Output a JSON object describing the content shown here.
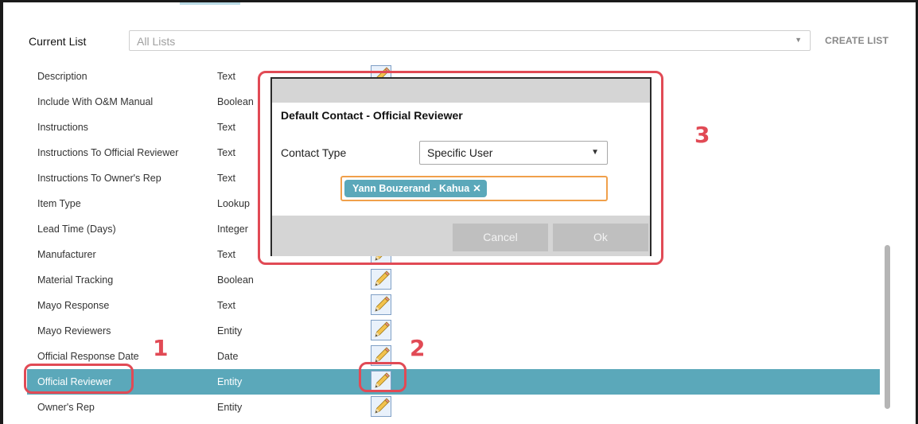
{
  "header": {
    "current_list_label": "Current List",
    "list_placeholder": "All Lists",
    "create_list_label": "CREATE LIST"
  },
  "fields": [
    {
      "name": "Description",
      "type": "Text"
    },
    {
      "name": "Include With O&M Manual",
      "type": "Boolean"
    },
    {
      "name": "Instructions",
      "type": "Text"
    },
    {
      "name": "Instructions To Official Reviewer",
      "type": "Text"
    },
    {
      "name": "Instructions To Owner's Rep",
      "type": "Text"
    },
    {
      "name": "Item Type",
      "type": "Lookup"
    },
    {
      "name": "Lead Time (Days)",
      "type": "Integer"
    },
    {
      "name": "Manufacturer",
      "type": "Text"
    },
    {
      "name": "Material Tracking",
      "type": "Boolean"
    },
    {
      "name": "Mayo Response",
      "type": "Text"
    },
    {
      "name": "Mayo Reviewers",
      "type": "Entity"
    },
    {
      "name": "Official Response Date",
      "type": "Date"
    },
    {
      "name": "Official Reviewer",
      "type": "Entity"
    },
    {
      "name": "Owner's Rep",
      "type": "Entity"
    }
  ],
  "selected_field": "Official Reviewer",
  "dialog": {
    "title": "Default Contact - Official Reviewer",
    "contact_type_label": "Contact Type",
    "contact_type_value": "Specific User",
    "selected_contact": "Yann Bouzerand - Kahua",
    "remove_symbol": "✕",
    "cancel_label": "Cancel",
    "ok_label": "Ok"
  },
  "annotations": [
    "1",
    "2",
    "3"
  ],
  "colors": {
    "selected_row": "#5ba8ba",
    "annotation": "#e14a55",
    "token": "#5ba8ba",
    "token_field_border": "#f0a04b",
    "dialog_bar": "#d5d5d5"
  },
  "icons": {
    "edit": "pencil-edit-icon",
    "dropdown": "chevron-down-icon",
    "remove": "close-icon"
  }
}
